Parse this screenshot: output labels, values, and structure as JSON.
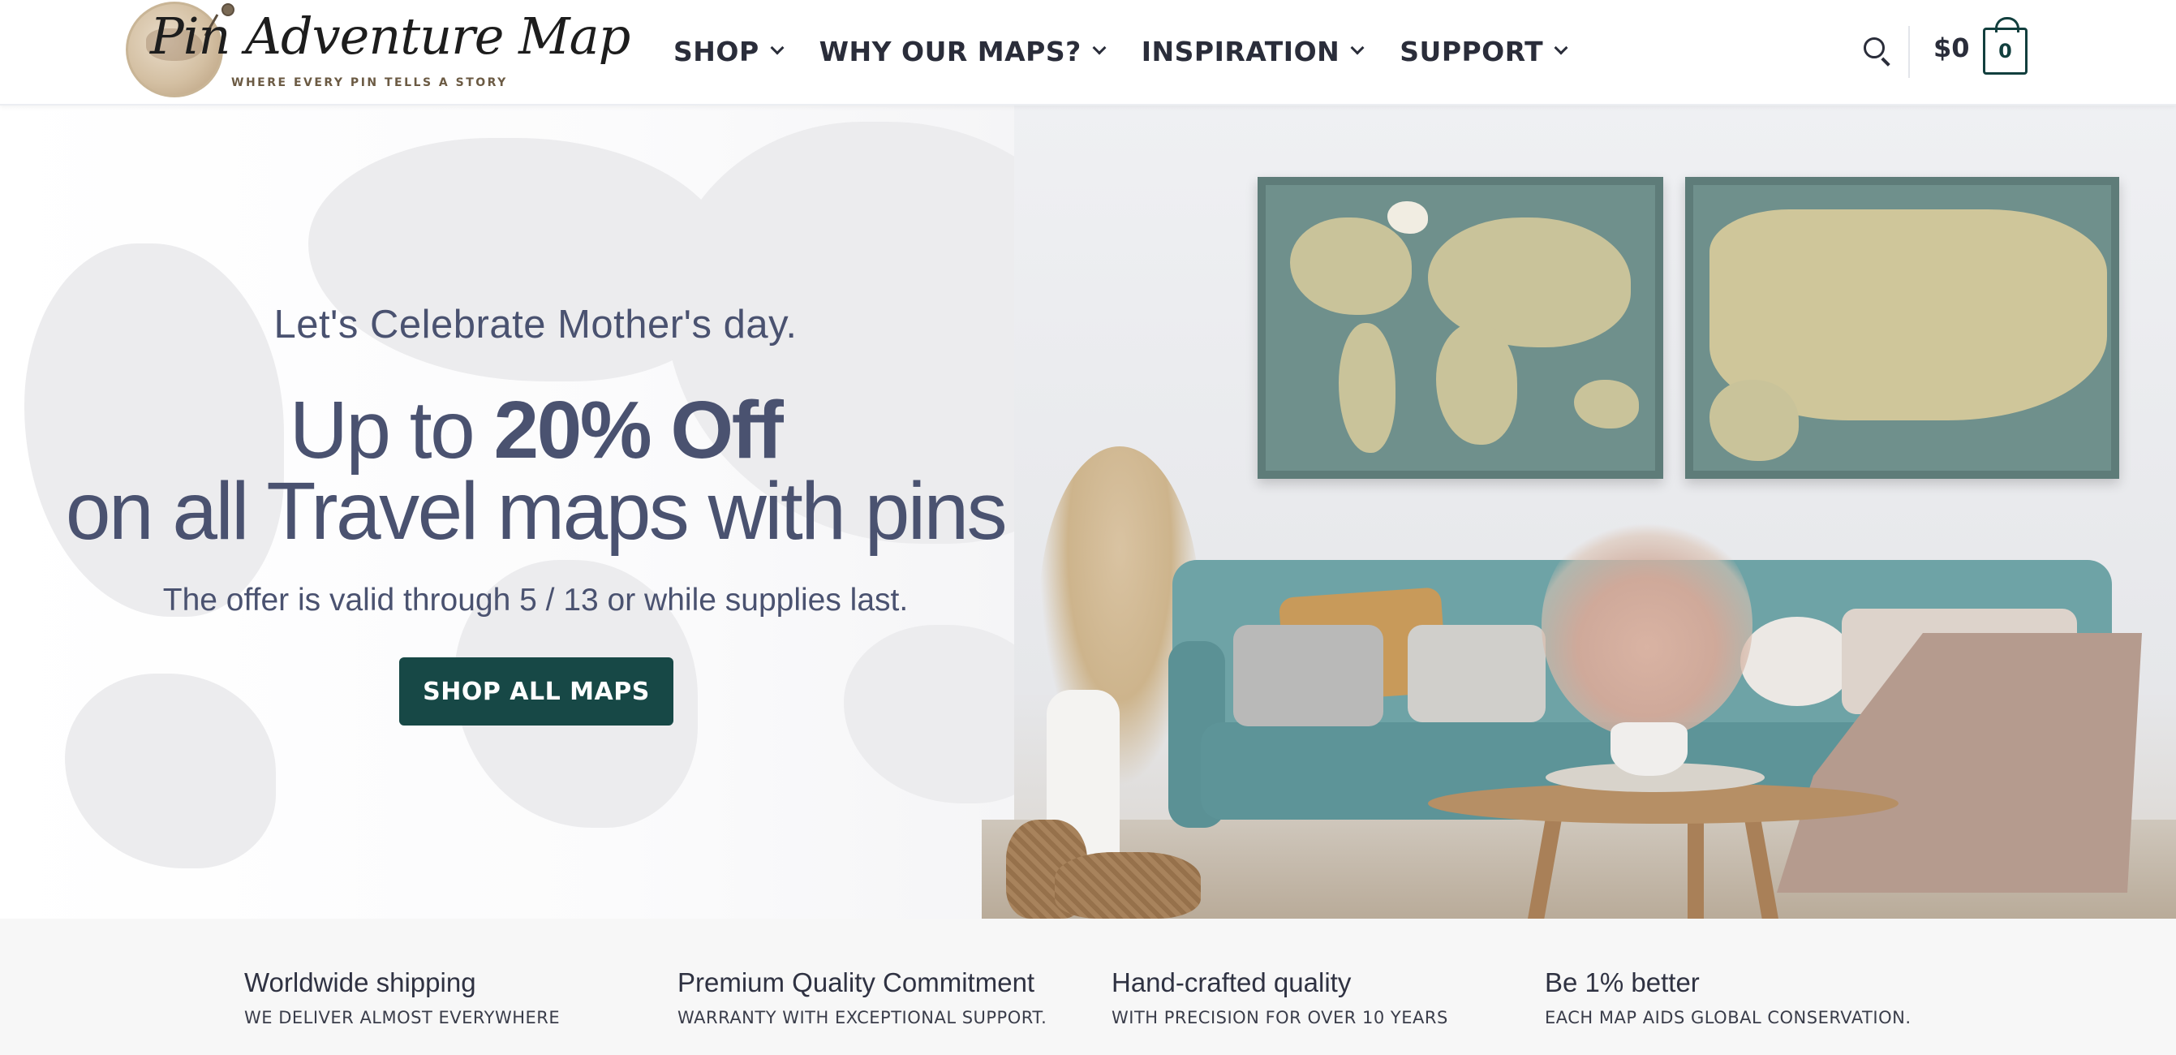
{
  "header": {
    "logo": {
      "name": "Pin Adventure Map",
      "tagline": "WHERE EVERY PIN TELLS A STORY"
    },
    "nav": [
      {
        "label": "SHOP"
      },
      {
        "label": "WHY OUR MAPS?"
      },
      {
        "label": "INSPIRATION"
      },
      {
        "label": "SUPPORT"
      }
    ],
    "icons": {
      "search": "search-icon",
      "cart": "shopping-bag-icon"
    },
    "cart_total": "$0",
    "cart_count": "0"
  },
  "hero": {
    "pretitle": "Let's Celebrate Mother's day.",
    "headline_prefix": "Up to ",
    "headline_highlight": "20% Off",
    "headline_line2": "on all Travel maps with pins",
    "offer": "The offer is valid through 5 / 13 or while supplies last.",
    "cta_label": "SHOP ALL MAPS"
  },
  "features": [
    {
      "title": "Worldwide shipping",
      "subtitle": "WE DELIVER ALMOST EVERYWHERE"
    },
    {
      "title": "Premium Quality Commitment",
      "subtitle": "WARRANTY WITH EXCEPTIONAL SUPPORT."
    },
    {
      "title": "Hand-crafted quality",
      "subtitle": "WITH PRECISION FOR OVER 10 YEARS"
    },
    {
      "title": "Be 1% better",
      "subtitle": "EACH MAP AIDS GLOBAL CONSERVATION."
    }
  ],
  "colors": {
    "brand_dark_green": "#174846",
    "text_slate": "#4a5270",
    "nav_text": "#2a2d3a"
  }
}
